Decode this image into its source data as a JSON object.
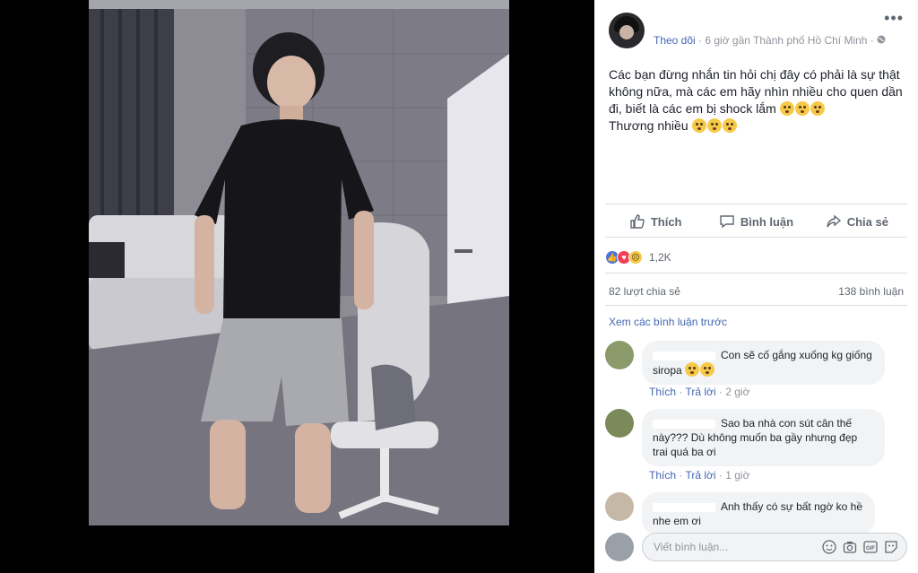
{
  "post": {
    "follow_label": "Theo dõi",
    "meta_text": " · 6 giờ gần Thành phố Hồ Chí Minh · ",
    "more_label": "•••",
    "text_line1": "Các bạn đừng nhắn tin hỏi chị đây có phải là sự thật không nữa, mà các em hãy nhìn nhiều cho quen dần đi, biết là các em bị shock lắm ",
    "text_line2": "Thương nhiều "
  },
  "actions": {
    "like": "Thích",
    "comment": "Bình luận",
    "share": "Chia sẻ"
  },
  "reactions": {
    "count": "1,2K"
  },
  "stats": {
    "shares": "82 lượt chia sẻ",
    "comments": "138 bình luận"
  },
  "more_comments_label": "Xem các bình luận trước",
  "comments": [
    {
      "text": "Con sẽ cố gắng xuống kg giống siropa ",
      "like": "Thích",
      "reply": "Trả lời",
      "time": "2 giờ"
    },
    {
      "text": "Sao ba nhà con sút cân thế này??? Dù không muốn ba gầy nhưng đẹp trai quá ba ơi",
      "like": "Thích",
      "reply": "Trả lời",
      "time": "1 giờ"
    },
    {
      "text": "Anh thấy có sự bất ngờ ko hề nhe em ơi"
    }
  ],
  "composer": {
    "placeholder": "Viết bình luận..."
  },
  "colors": {
    "link": "#4267b2",
    "secondary_text": "#90949c",
    "bubble": "#f2f3f5"
  }
}
